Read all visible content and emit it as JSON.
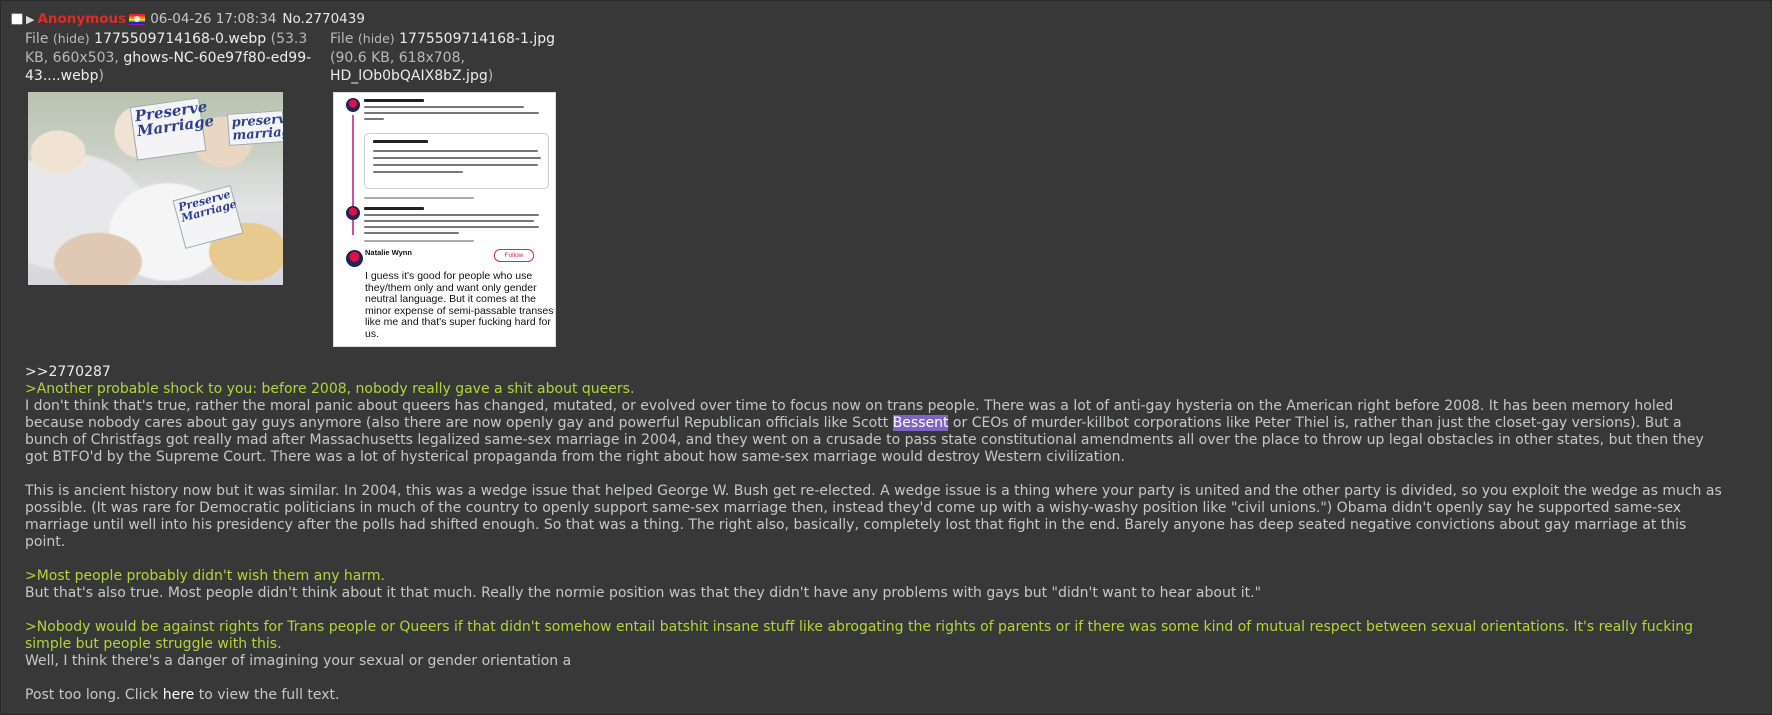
{
  "post": {
    "name": "Anonymous",
    "date": "06-04-26 17:08:34",
    "number": "No.2770439",
    "menu_glyph": "▶",
    "flag_icon": "pride-flag-icon"
  },
  "files": [
    {
      "label": "File",
      "hide": "(hide)",
      "filename": "1775509714168-0.webp",
      "meta_pre": " (53.3 KB, 660x503, ",
      "original": "ghows-NC-60e97f80-ed99-43....webp",
      "meta_post": ")",
      "sign_texts": [
        "Preserve Marriage",
        "preserve marriage",
        "Preserve Marriage"
      ]
    },
    {
      "label": "File",
      "hide": "(hide)",
      "filename": "1775509714168-1.jpg",
      "meta_pre": "(90.6 KB, 618x708, ",
      "original": "HD_lOb0bQAIX8bZ.jpg",
      "meta_post": ")",
      "tweet_author": "Natalie Wynn",
      "tweet_follow": "Follow",
      "tweet_text": "I guess it's good for people who use they/them only and want only gender neutral language. But it comes at the minor expense of semi-passable transes like me and that's super fucking hard for us."
    }
  ],
  "body": {
    "quotelink": ">>2770287",
    "green1": ">Another probable shock to you: before 2008, nobody really gave a shit about queers.",
    "para1_a": "I don't think that's true, rather the moral panic about queers has changed, mutated, or evolved over time to focus now on trans people. There was a lot of anti-gay hysteria on the American right before 2008. It has been memory holed because nobody cares about gay guys anymore (also there are now openly gay and powerful Republican officials like Scott ",
    "para1_highlight": "Bessent",
    "para1_b": " or CEOs of murder-killbot corporations like Peter Thiel is, rather than just the closet-gay versions). But a bunch of Christfags got really mad after Massachusetts legalized same-sex marriage in 2004, and they went on a crusade to pass state constitutional amendments all over the place to throw up legal obstacles in other states, but then they got BTFO'd by the Supreme Court. There was a lot of hysterical propaganda from the right about how same-sex marriage would destroy Western civilization.",
    "para2": "This is ancient history now but it was similar. In 2004, this was a wedge issue that helped George W. Bush get re-elected. A wedge issue is a thing where your party is united and the other party is divided, so you exploit the wedge as much as possible. (It was rare for Democratic politicians in much of the country to openly support same-sex marriage then, instead they'd come up with a wishy-washy position like \"civil unions.\") Obama didn't openly say he supported same-sex marriage until well into his presidency after the polls had shifted enough. So that was a thing. The right also, basically, completely lost that fight in the end. Barely anyone has deep seated negative convictions about gay marriage at this point.",
    "green2": ">Most people probably didn't wish them any harm.",
    "para3": "But that's also true. Most people didn't think about it that much. Really the normie position was that they didn't have any problems with gays but \"didn't want to hear about it.\"",
    "green3": ">Nobody would be against rights for Trans people or Queers if that didn't somehow entail batshit insane stuff like abrogating the rights of parents or if there was some kind of mutual respect between sexual orientations. It's really fucking simple but people struggle with this.",
    "para4": "Well, I think there's a danger of imagining your sexual or gender orientation a",
    "too_long_pre": "Post too long. Click ",
    "too_long_link": "here",
    "too_long_post": " to view the full text."
  },
  "colors": {
    "background": "#383838",
    "name": "#e02a2a",
    "greentext": "#b5d33a",
    "highlight": "#7f63c3"
  }
}
